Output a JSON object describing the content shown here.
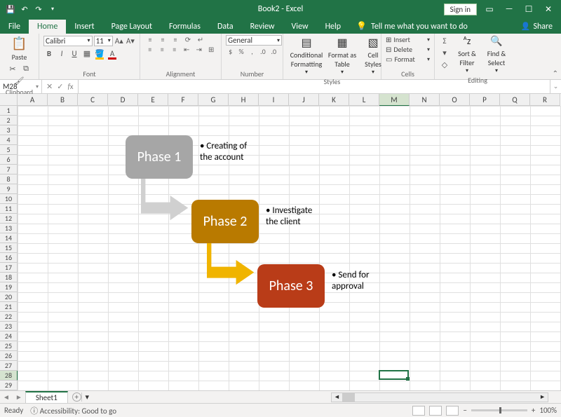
{
  "titlebar": {
    "title": "Book2 - Excel",
    "signin": "Sign in"
  },
  "tabs": [
    "File",
    "Home",
    "Insert",
    "Page Layout",
    "Formulas",
    "Data",
    "Review",
    "View",
    "Help"
  ],
  "tellme": "Tell me what you want to do",
  "share": "Share",
  "ribbon": {
    "clipboard": {
      "paste": "Paste",
      "label": "Clipboard"
    },
    "font": {
      "name": "Calibri",
      "size": "11",
      "label": "Font"
    },
    "alignment": {
      "label": "Alignment"
    },
    "number": {
      "format": "General",
      "label": "Number"
    },
    "styles": {
      "cond": "Conditional Formatting",
      "fmt": "Format as Table",
      "cell": "Cell Styles",
      "label": "Styles"
    },
    "cells": {
      "insert": "Insert",
      "delete": "Delete",
      "format": "Format",
      "label": "Cells"
    },
    "editing": {
      "sort": "Sort & Filter",
      "find": "Find & Select",
      "label": "Editing"
    }
  },
  "namebox": "M28",
  "columns": [
    "A",
    "B",
    "C",
    "D",
    "E",
    "F",
    "G",
    "H",
    "I",
    "J",
    "K",
    "L",
    "M",
    "N",
    "O",
    "P",
    "Q",
    "R"
  ],
  "selectedCol": "M",
  "selectedRow": 28,
  "rowCount": 29,
  "smartart": {
    "p1": {
      "title": "Phase 1",
      "text": "Creating of the account"
    },
    "p2": {
      "title": "Phase 2",
      "text": "Investigate the client"
    },
    "p3": {
      "title": "Phase 3",
      "text": "Send for approval"
    }
  },
  "sheet": {
    "name": "Sheet1"
  },
  "status": {
    "ready": "Ready",
    "accessibility": "Accessibility: Good to go",
    "zoom": "100%"
  }
}
